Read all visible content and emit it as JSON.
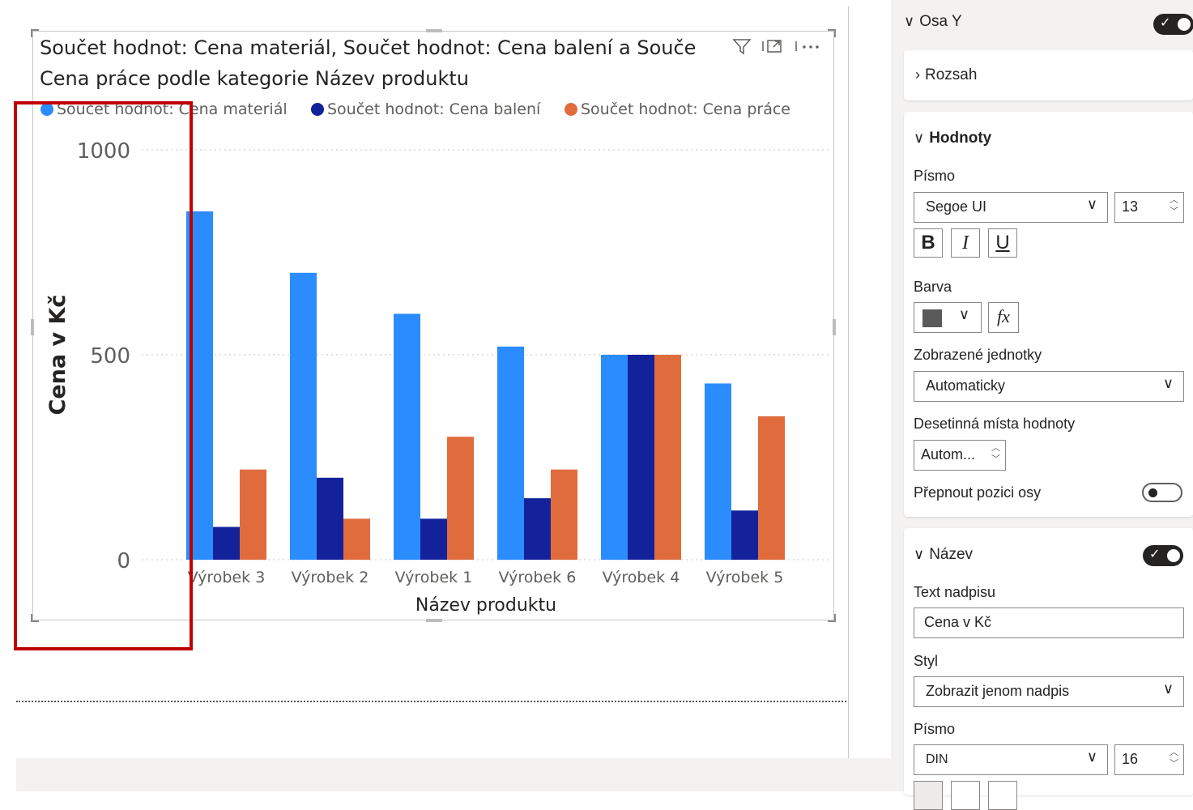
{
  "visual": {
    "title_line1": "Součet hodnot: Cena materiál, Součet hodnot: Cena balení a Souče",
    "title_line2": "Cena práce podle kategorie Název produktu",
    "icons": [
      "filter-icon",
      "focus-mode-icon",
      "more-options-icon"
    ]
  },
  "chart_data": {
    "type": "bar",
    "categories": [
      "Výrobek 3",
      "Výrobek 2",
      "Výrobek 1",
      "Výrobek 6",
      "Výrobek 4",
      "Výrobek 5"
    ],
    "series": [
      {
        "name": "Součet hodnot: Cena materiál",
        "color": "#2b8cff",
        "values": [
          850,
          700,
          600,
          520,
          500,
          430
        ]
      },
      {
        "name": "Součet hodnot: Cena balení",
        "color": "#13229a",
        "values": [
          80,
          200,
          100,
          150,
          500,
          120
        ]
      },
      {
        "name": "Součet hodnot: Cena práce",
        "color": "#e06c3d",
        "values": [
          220,
          100,
          300,
          220,
          500,
          350
        ]
      }
    ],
    "yticks": [
      0,
      500,
      1000
    ],
    "ylim": [
      0,
      1000
    ],
    "ylabel": "Cena v Kč",
    "xlabel": "Název produktu",
    "legend_position": "top-left",
    "grid": true
  },
  "pane": {
    "osa_y": {
      "label": "Osa Y",
      "toggle": "on"
    },
    "rozsah": {
      "label": "Rozsah"
    },
    "hodnoty": {
      "label": "Hodnoty",
      "pismo_label": "Písmo",
      "font": "Segoe UI",
      "size": "13",
      "bold": "B",
      "italic": "I",
      "underline": "U",
      "barva_label": "Barva",
      "color": "#595959",
      "fx": "fx",
      "units_label": "Zobrazené jednotky",
      "units": "Automaticky",
      "decimals_label": "Desetinná místa hodnoty",
      "decimals": "Autom...",
      "switch_label": "Přepnout pozici osy",
      "switch": "off"
    },
    "nazev": {
      "label": "Název",
      "toggle": "on",
      "text_label": "Text nadpisu",
      "text": "Cena v Kč",
      "style_label": "Styl",
      "style": "Zobrazit jenom nadpis",
      "font_label": "Písmo",
      "font": "DIN",
      "size": "16"
    }
  }
}
